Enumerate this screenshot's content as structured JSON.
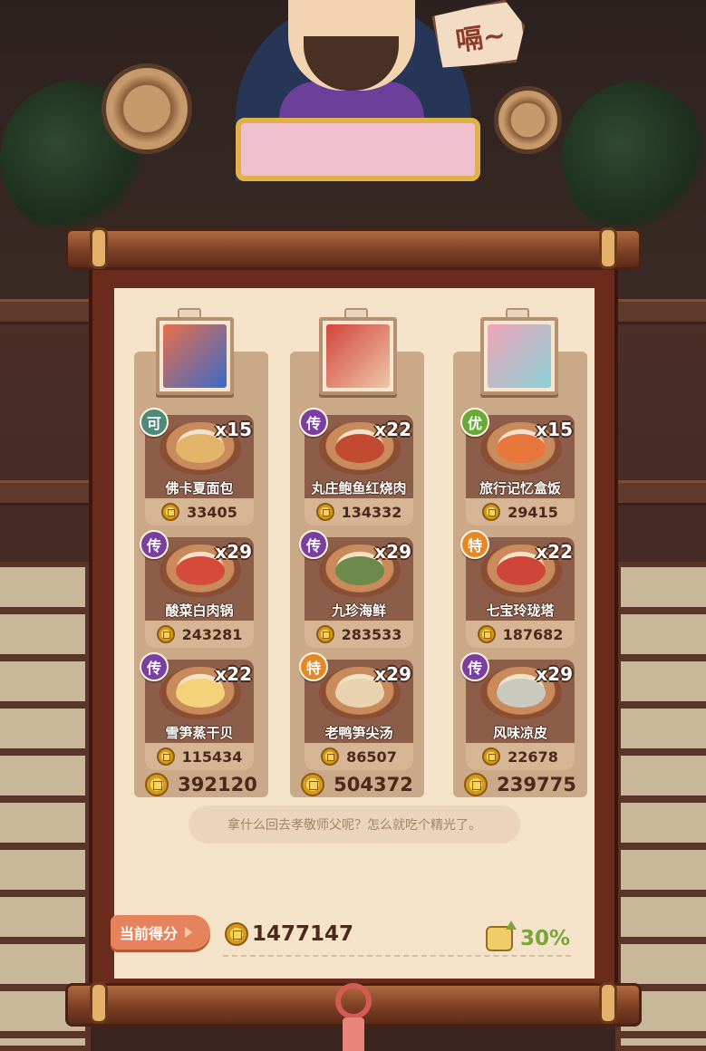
{
  "npc": {
    "speech_sign": "嗝~"
  },
  "columns": [
    {
      "guest": {
        "avatar": "guest-1"
      },
      "dishes": [
        {
          "rarity": "可",
          "rarity_color": "#4d8a7a",
          "qty": "x15",
          "name": "佛卡夏面包",
          "score": "33405",
          "food_color": "#e2b46a"
        },
        {
          "rarity": "传",
          "rarity_color": "#7a3fa0",
          "qty": "x29",
          "name": "酸菜白肉锅",
          "score": "243281",
          "food_color": "#d64a3a"
        },
        {
          "rarity": "传",
          "rarity_color": "#7a3fa0",
          "qty": "x22",
          "name": "雪笋蒸干贝",
          "score": "115434",
          "food_color": "#f3d27a"
        }
      ],
      "total": "392120"
    },
    {
      "guest": {
        "avatar": "guest-2"
      },
      "dishes": [
        {
          "rarity": "传",
          "rarity_color": "#7a3fa0",
          "qty": "x22",
          "name": "丸庄鲍鱼红烧肉",
          "score": "134332",
          "food_color": "#c24a30"
        },
        {
          "rarity": "传",
          "rarity_color": "#7a3fa0",
          "qty": "x29",
          "name": "九珍海鲜",
          "score": "283533",
          "food_color": "#6e8a4a"
        },
        {
          "rarity": "特",
          "rarity_color": "#e3892a",
          "qty": "x29",
          "name": "老鸭笋尖汤",
          "score": "86507",
          "food_color": "#e9d2b0"
        }
      ],
      "total": "504372"
    },
    {
      "guest": {
        "avatar": "guest-3"
      },
      "dishes": [
        {
          "rarity": "优",
          "rarity_color": "#6aa83a",
          "qty": "x15",
          "name": "旅行记忆盒饭",
          "score": "29415",
          "food_color": "#e8763a"
        },
        {
          "rarity": "特",
          "rarity_color": "#e3892a",
          "qty": "x22",
          "name": "七宝玲珑塔",
          "score": "187682",
          "food_color": "#d0453a"
        },
        {
          "rarity": "传",
          "rarity_color": "#7a3fa0",
          "qty": "x29",
          "name": "风味凉皮",
          "score": "22678",
          "food_color": "#c9c9c0"
        }
      ],
      "total": "239775"
    }
  ],
  "comment": "拿什么回去孝敬师父呢？怎么就吃个精光了。",
  "current_score": {
    "label": "当前得分",
    "value": "1477147"
  },
  "bonus": {
    "percent": "30%"
  }
}
